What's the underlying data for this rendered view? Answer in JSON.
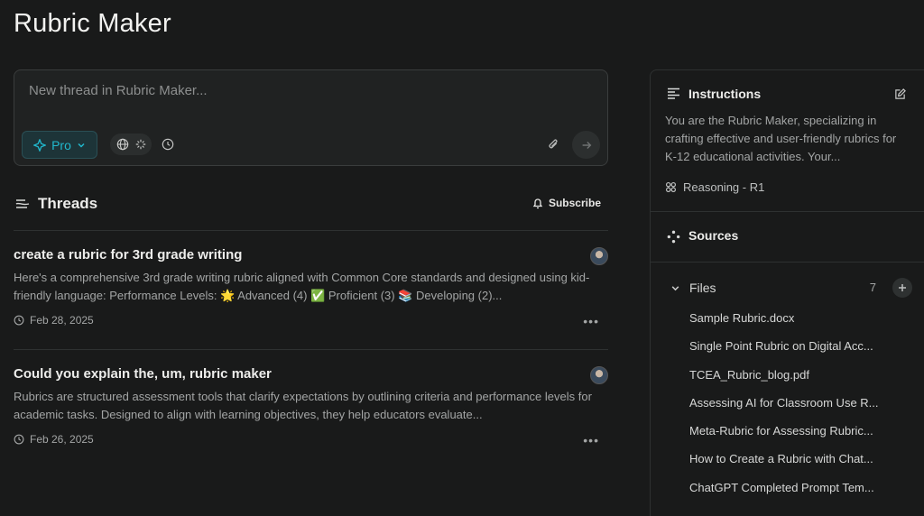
{
  "page": {
    "title": "Rubric Maker"
  },
  "composer": {
    "placeholder": "New thread in Rubric Maker...",
    "mode_label": "Pro"
  },
  "threads": {
    "title": "Threads",
    "subscribe_label": "Subscribe",
    "items": [
      {
        "title": "create a rubric for 3rd grade writing",
        "snippet": "Here's a comprehensive 3rd grade writing rubric aligned with Common Core standards and designed using kid-friendly language: Performance Levels: 🌟 Advanced (4) ✅ Proficient (3) 📚 Developing (2)...",
        "date": "Feb 28, 2025"
      },
      {
        "title": "Could you explain the, um, rubric maker",
        "snippet": "Rubrics are structured assessment tools that clarify expectations by outlining criteria and performance levels for academic tasks. Designed to align with learning objectives, they help educators evaluate...",
        "date": "Feb 26, 2025"
      }
    ]
  },
  "panel": {
    "instructions_title": "Instructions",
    "instructions_text": "You are the Rubric Maker, specializing in crafting effective and user-friendly rubrics for K-12 educational activities. Your...",
    "model_label": "Reasoning - R1",
    "sources_title": "Sources",
    "files_label": "Files",
    "files_count": "7",
    "files": [
      "Sample Rubric.docx",
      "Single Point Rubric on Digital Acc...",
      "TCEA_Rubric_blog.pdf",
      "Assessing AI for Classroom Use R...",
      "Meta-Rubric for Assessing Rubric...",
      "How to Create a Rubric with Chat...",
      "ChatGPT Completed Prompt Tem..."
    ]
  },
  "colors": {
    "background": "#191a1a",
    "accent": "#21b8cd",
    "muted_text": "#a3a5a5"
  }
}
